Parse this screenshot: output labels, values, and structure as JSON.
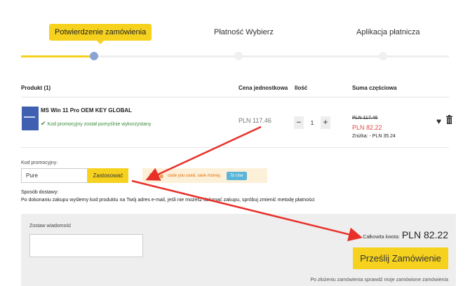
{
  "stepper": {
    "steps": [
      {
        "label": "Potwierdzenie zamówienia",
        "active": true
      },
      {
        "label": "Płatność Wybierz",
        "active": false
      },
      {
        "label": "Aplikacja płatnicza",
        "active": false
      }
    ]
  },
  "table": {
    "headers": {
      "product": "Produkt (1)",
      "unit_price": "Cena jednostkowa",
      "quantity": "Ilość",
      "subtotal": "Suma częściowa"
    },
    "item": {
      "name": "MS Win 11 Pro OEM KEY GLOBAL",
      "promo_status": "Kod promocyjny został pomyślnie wykorzystany",
      "unit_price": "PLN 117.46",
      "quantity": "1",
      "old_price": "PLN 117.46",
      "new_price": "PLN 82.22",
      "discount": "Zniżka: - PLN 35.24"
    }
  },
  "promo": {
    "label": "Kod promocyjny:",
    "value": "Pure",
    "apply_label": "Zastosować",
    "tip_code": "Pure",
    "tip_message": "code you used, save money.",
    "tip_button": "To Use"
  },
  "shipping": {
    "label": "Sposób dostawy:",
    "text": "Po dokonaniu zakupu wyślemy kod produktu na Twój adres e-mail, jeśli nie możesz dokonać zakupu, spróbuj zmienić metodę płatności"
  },
  "checkout": {
    "message_label": "Zostaw wiadomość",
    "total_label": "Całkowita kwota:",
    "total_value": "PLN 82.22",
    "submit_label": "Prześlij Zamówienie",
    "note": "Po złożeniu zamówienia sprawdź moje zamówione zamówienia"
  },
  "colors": {
    "accent": "#f6d21f",
    "annotation": "#e8302a",
    "success": "#3b8a3b",
    "discount_price": "#e04848"
  },
  "icons": [
    "check-icon",
    "heart-icon",
    "trash-icon",
    "minus-icon",
    "plus-icon"
  ]
}
